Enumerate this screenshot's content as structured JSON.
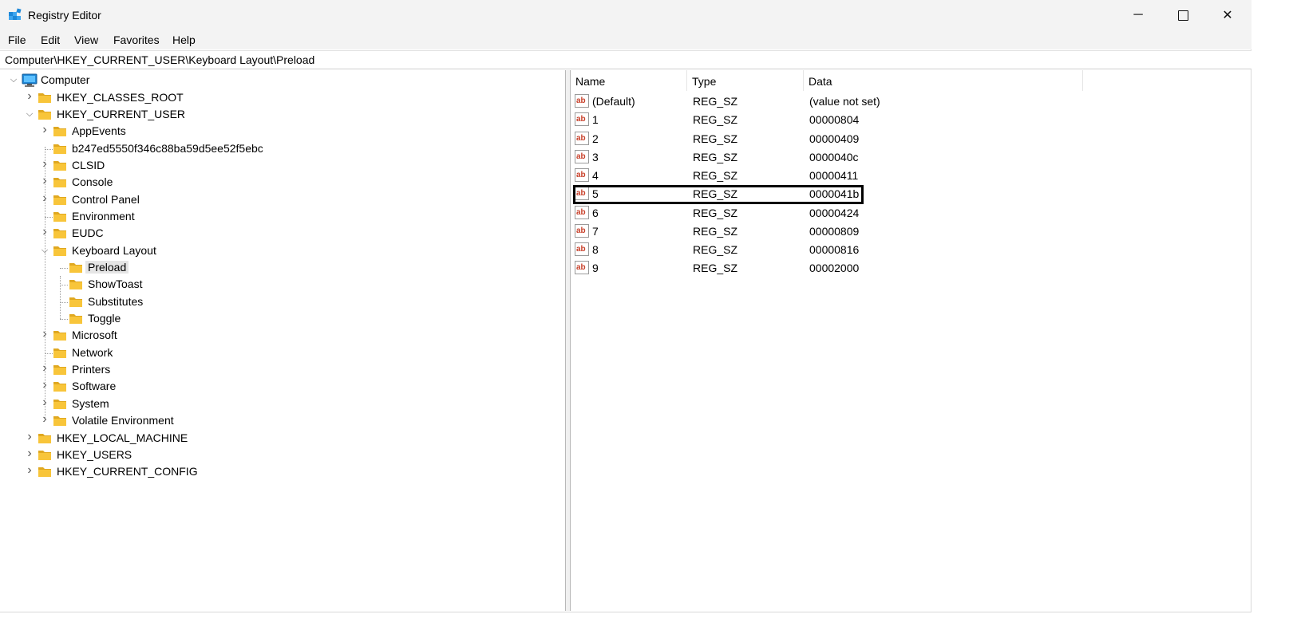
{
  "window": {
    "title": "Registry Editor",
    "icon": "registry-editor-icon",
    "controls": {
      "minimize": "─",
      "maximize": "☐",
      "close": "✕"
    }
  },
  "menu": [
    "File",
    "Edit",
    "View",
    "Favorites",
    "Help"
  ],
  "address": "Computer\\HKEY_CURRENT_USER\\Keyboard Layout\\Preload",
  "tree": {
    "root": "Computer",
    "nodes": [
      {
        "label": "HKEY_CLASSES_ROOT",
        "state": "collapsed"
      },
      {
        "label": "HKEY_CURRENT_USER",
        "state": "expanded"
      },
      {
        "label": "AppEvents",
        "state": "collapsed"
      },
      {
        "label": "b247ed5550f346c88ba59d5ee52f5ebc",
        "state": "leaf"
      },
      {
        "label": "CLSID",
        "state": "collapsed"
      },
      {
        "label": "Console",
        "state": "collapsed"
      },
      {
        "label": "Control Panel",
        "state": "collapsed"
      },
      {
        "label": "Environment",
        "state": "leaf"
      },
      {
        "label": "EUDC",
        "state": "collapsed"
      },
      {
        "label": "Keyboard Layout",
        "state": "expanded"
      },
      {
        "label": "Preload",
        "state": "selected"
      },
      {
        "label": "ShowToast",
        "state": "leaf"
      },
      {
        "label": "Substitutes",
        "state": "leaf"
      },
      {
        "label": "Toggle",
        "state": "leaf"
      },
      {
        "label": "Microsoft",
        "state": "collapsed"
      },
      {
        "label": "Network",
        "state": "leaf"
      },
      {
        "label": "Printers",
        "state": "collapsed"
      },
      {
        "label": "Software",
        "state": "collapsed"
      },
      {
        "label": "System",
        "state": "collapsed"
      },
      {
        "label": "Volatile Environment",
        "state": "collapsed"
      },
      {
        "label": "HKEY_LOCAL_MACHINE",
        "state": "collapsed"
      },
      {
        "label": "HKEY_USERS",
        "state": "collapsed"
      },
      {
        "label": "HKEY_CURRENT_CONFIG",
        "state": "collapsed"
      }
    ]
  },
  "list": {
    "columns": [
      "Name",
      "Type",
      "Data"
    ],
    "rows": [
      {
        "name": "(Default)",
        "type": "REG_SZ",
        "data": "(value not set)"
      },
      {
        "name": "1",
        "type": "REG_SZ",
        "data": "00000804"
      },
      {
        "name": "2",
        "type": "REG_SZ",
        "data": "00000409"
      },
      {
        "name": "3",
        "type": "REG_SZ",
        "data": "0000040c"
      },
      {
        "name": "4",
        "type": "REG_SZ",
        "data": "00000411"
      },
      {
        "name": "5",
        "type": "REG_SZ",
        "data": "0000041b"
      },
      {
        "name": "6",
        "type": "REG_SZ",
        "data": "00000424"
      },
      {
        "name": "7",
        "type": "REG_SZ",
        "data": "00000809"
      },
      {
        "name": "8",
        "type": "REG_SZ",
        "data": "00000816"
      },
      {
        "name": "9",
        "type": "REG_SZ",
        "data": "00002000"
      }
    ],
    "highlighted_row": "5"
  },
  "colors": {
    "folder": "#f8c53a",
    "folder_dark": "#e0a820",
    "value_icon_red": "#c8402a",
    "computer_icon": "#1e88d8",
    "selection": "#e5e5e5"
  }
}
